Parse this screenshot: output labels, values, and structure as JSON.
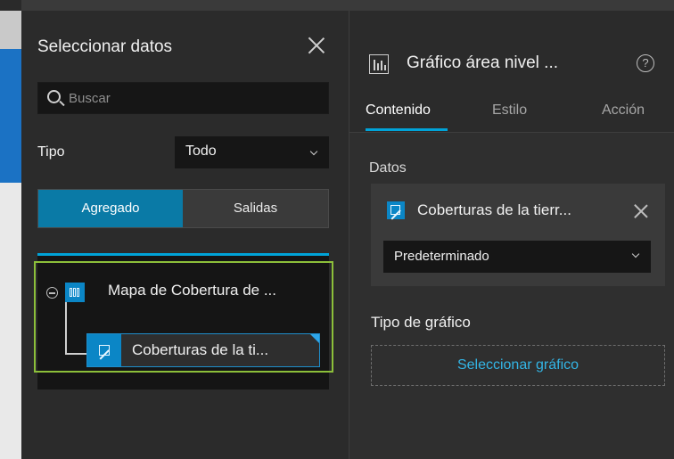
{
  "left_panel": {
    "title": "Seleccionar datos",
    "search_placeholder": "Buscar",
    "tipo_label": "Tipo",
    "tipo_value": "Todo",
    "segments": {
      "active": "Agregado",
      "other": "Salidas"
    },
    "tree": {
      "map_label": "Mapa de Cobertura de ...",
      "child_label": "Coberturas de la ti..."
    }
  },
  "right_panel": {
    "title": "Gráfico área nivel ...",
    "help_glyph": "?",
    "tabs": [
      "Contenido",
      "Estilo",
      "Acción"
    ],
    "datos_label": "Datos",
    "data_source": "Coberturas de la tierr...",
    "view_value": "Predeterminado",
    "chart_type_label": "Tipo de gráfico",
    "select_chart_label": "Seleccionar gráfico"
  },
  "colors": {
    "accent": "#00a3d8",
    "segment_active": "#0a7aa6",
    "highlight_border": "#8cbf3a",
    "icon_blue": "#0b86c6"
  },
  "icons": {
    "close": "close-icon",
    "search": "search-icon",
    "chevron": "chevron-down-icon",
    "map": "map-icon",
    "layer": "layer-flag-icon",
    "chart": "bar-chart-icon",
    "help": "help-icon"
  }
}
